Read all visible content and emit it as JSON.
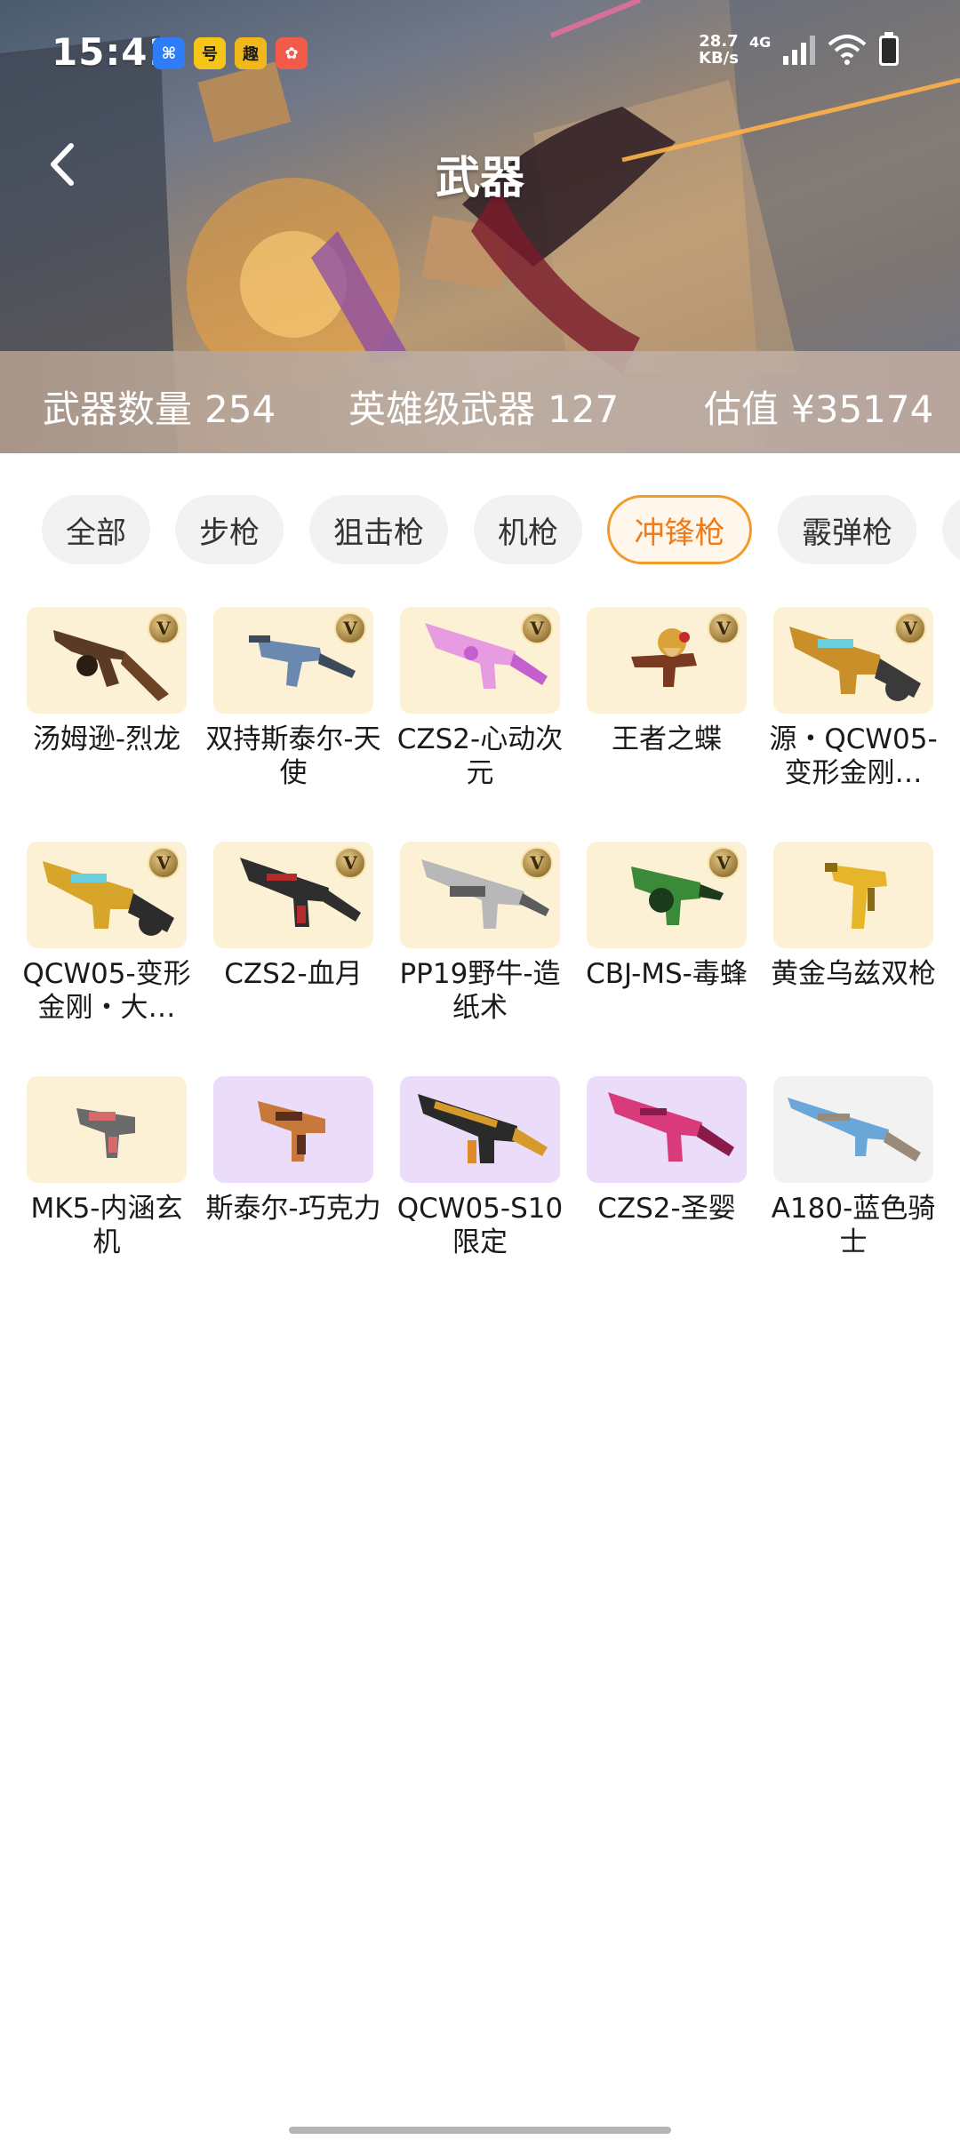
{
  "status_bar": {
    "time": "15:41",
    "apps": [
      {
        "name": "blue-app-icon",
        "glyph": "⌘",
        "color": "#2f7df6"
      },
      {
        "name": "game-app-icon",
        "glyph": "号",
        "color": "#f5c518"
      },
      {
        "name": "fun-app-icon",
        "glyph": "趣",
        "color": "#f2b81a"
      },
      {
        "name": "red-app-icon",
        "glyph": "✿",
        "color": "#f25b4a"
      }
    ],
    "speed_value": "28.7",
    "speed_unit": "KB/s",
    "network": "4G"
  },
  "header": {
    "title": "武器",
    "back_icon": "chevron-left-icon"
  },
  "stats": {
    "count_label": "武器数量",
    "count_value": "254",
    "hero_label": "英雄级武器",
    "hero_value": "127",
    "value_label": "估值",
    "value_value": "¥35174"
  },
  "tabs": [
    {
      "label": "全部",
      "active": false
    },
    {
      "label": "步枪",
      "active": false
    },
    {
      "label": "狙击枪",
      "active": false
    },
    {
      "label": "机枪",
      "active": false
    },
    {
      "label": "冲锋枪",
      "active": true
    },
    {
      "label": "霰弹枪",
      "active": false
    },
    {
      "label": "",
      "active": false
    }
  ],
  "badge_text": "V",
  "weapons": [
    {
      "name": "汤姆逊-烈龙",
      "bg": "gold",
      "hero": true,
      "colors": [
        "#5a3a22",
        "#2b1d12"
      ]
    },
    {
      "name": "双持斯泰尔-天使",
      "bg": "gold",
      "hero": true,
      "colors": [
        "#6a88b0",
        "#3c4a5c"
      ]
    },
    {
      "name": "CZS2-心动次元",
      "bg": "gold",
      "hero": true,
      "colors": [
        "#e79be0",
        "#c35fcf"
      ]
    },
    {
      "name": "王者之蝶",
      "bg": "gold",
      "hero": true,
      "colors": [
        "#d9a33a",
        "#7a3a22"
      ]
    },
    {
      "name": "源・QCW05-变形金刚…",
      "bg": "gold",
      "hero": true,
      "colors": [
        "#c9902a",
        "#3a3a3a"
      ]
    },
    {
      "name": "QCW05-变形金刚・大…",
      "bg": "gold",
      "hero": true,
      "colors": [
        "#d8a52c",
        "#2c2c2c"
      ]
    },
    {
      "name": "CZS2-血月",
      "bg": "gold",
      "hero": true,
      "colors": [
        "#b52a2a",
        "#2e2e2e"
      ]
    },
    {
      "name": "PP19野牛-造纸术",
      "bg": "gold",
      "hero": true,
      "colors": [
        "#b8b8b8",
        "#5c5c5c"
      ]
    },
    {
      "name": "CBJ-MS-毒蜂",
      "bg": "gold",
      "hero": true,
      "colors": [
        "#3a8a3a",
        "#1c3a1c"
      ]
    },
    {
      "name": "黄金乌兹双枪",
      "bg": "gold",
      "hero": false,
      "colors": [
        "#e6b52a",
        "#8a6a12"
      ]
    },
    {
      "name": "MK5-内涵玄机",
      "bg": "gold",
      "hero": false,
      "colors": [
        "#d76a6a",
        "#6a6a6a"
      ]
    },
    {
      "name": "斯泰尔-巧克力",
      "bg": "purple",
      "hero": false,
      "colors": [
        "#c8783a",
        "#5a2e1a"
      ]
    },
    {
      "name": "QCW05-S10限定",
      "bg": "purple",
      "hero": false,
      "colors": [
        "#d69a2a",
        "#2a2a2a"
      ]
    },
    {
      "name": "CZS2-圣婴",
      "bg": "purple",
      "hero": false,
      "colors": [
        "#d83a7a",
        "#8a1a4a"
      ]
    },
    {
      "name": "A180-蓝色骑士",
      "bg": "gray",
      "hero": false,
      "colors": [
        "#6aa7d8",
        "#9a8a7a"
      ]
    }
  ]
}
